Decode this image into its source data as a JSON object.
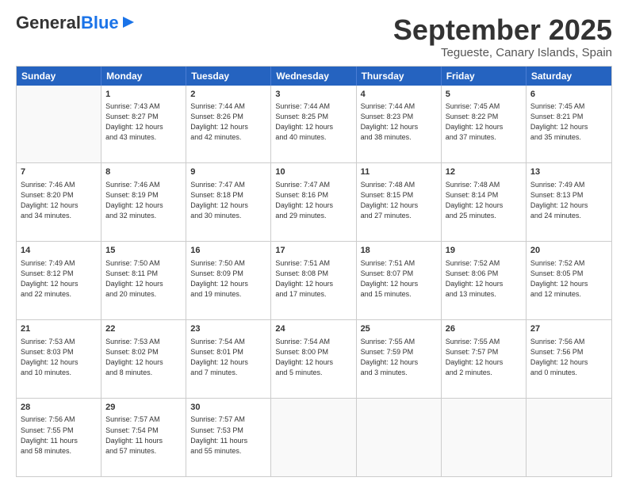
{
  "header": {
    "logo_general": "General",
    "logo_blue": "Blue",
    "main_title": "September 2025",
    "subtitle": "Tegueste, Canary Islands, Spain"
  },
  "calendar": {
    "weekdays": [
      "Sunday",
      "Monday",
      "Tuesday",
      "Wednesday",
      "Thursday",
      "Friday",
      "Saturday"
    ],
    "rows": [
      [
        {
          "day": "",
          "text": ""
        },
        {
          "day": "1",
          "text": "Sunrise: 7:43 AM\nSunset: 8:27 PM\nDaylight: 12 hours\nand 43 minutes."
        },
        {
          "day": "2",
          "text": "Sunrise: 7:44 AM\nSunset: 8:26 PM\nDaylight: 12 hours\nand 42 minutes."
        },
        {
          "day": "3",
          "text": "Sunrise: 7:44 AM\nSunset: 8:25 PM\nDaylight: 12 hours\nand 40 minutes."
        },
        {
          "day": "4",
          "text": "Sunrise: 7:44 AM\nSunset: 8:23 PM\nDaylight: 12 hours\nand 38 minutes."
        },
        {
          "day": "5",
          "text": "Sunrise: 7:45 AM\nSunset: 8:22 PM\nDaylight: 12 hours\nand 37 minutes."
        },
        {
          "day": "6",
          "text": "Sunrise: 7:45 AM\nSunset: 8:21 PM\nDaylight: 12 hours\nand 35 minutes."
        }
      ],
      [
        {
          "day": "7",
          "text": "Sunrise: 7:46 AM\nSunset: 8:20 PM\nDaylight: 12 hours\nand 34 minutes."
        },
        {
          "day": "8",
          "text": "Sunrise: 7:46 AM\nSunset: 8:19 PM\nDaylight: 12 hours\nand 32 minutes."
        },
        {
          "day": "9",
          "text": "Sunrise: 7:47 AM\nSunset: 8:18 PM\nDaylight: 12 hours\nand 30 minutes."
        },
        {
          "day": "10",
          "text": "Sunrise: 7:47 AM\nSunset: 8:16 PM\nDaylight: 12 hours\nand 29 minutes."
        },
        {
          "day": "11",
          "text": "Sunrise: 7:48 AM\nSunset: 8:15 PM\nDaylight: 12 hours\nand 27 minutes."
        },
        {
          "day": "12",
          "text": "Sunrise: 7:48 AM\nSunset: 8:14 PM\nDaylight: 12 hours\nand 25 minutes."
        },
        {
          "day": "13",
          "text": "Sunrise: 7:49 AM\nSunset: 8:13 PM\nDaylight: 12 hours\nand 24 minutes."
        }
      ],
      [
        {
          "day": "14",
          "text": "Sunrise: 7:49 AM\nSunset: 8:12 PM\nDaylight: 12 hours\nand 22 minutes."
        },
        {
          "day": "15",
          "text": "Sunrise: 7:50 AM\nSunset: 8:11 PM\nDaylight: 12 hours\nand 20 minutes."
        },
        {
          "day": "16",
          "text": "Sunrise: 7:50 AM\nSunset: 8:09 PM\nDaylight: 12 hours\nand 19 minutes."
        },
        {
          "day": "17",
          "text": "Sunrise: 7:51 AM\nSunset: 8:08 PM\nDaylight: 12 hours\nand 17 minutes."
        },
        {
          "day": "18",
          "text": "Sunrise: 7:51 AM\nSunset: 8:07 PM\nDaylight: 12 hours\nand 15 minutes."
        },
        {
          "day": "19",
          "text": "Sunrise: 7:52 AM\nSunset: 8:06 PM\nDaylight: 12 hours\nand 13 minutes."
        },
        {
          "day": "20",
          "text": "Sunrise: 7:52 AM\nSunset: 8:05 PM\nDaylight: 12 hours\nand 12 minutes."
        }
      ],
      [
        {
          "day": "21",
          "text": "Sunrise: 7:53 AM\nSunset: 8:03 PM\nDaylight: 12 hours\nand 10 minutes."
        },
        {
          "day": "22",
          "text": "Sunrise: 7:53 AM\nSunset: 8:02 PM\nDaylight: 12 hours\nand 8 minutes."
        },
        {
          "day": "23",
          "text": "Sunrise: 7:54 AM\nSunset: 8:01 PM\nDaylight: 12 hours\nand 7 minutes."
        },
        {
          "day": "24",
          "text": "Sunrise: 7:54 AM\nSunset: 8:00 PM\nDaylight: 12 hours\nand 5 minutes."
        },
        {
          "day": "25",
          "text": "Sunrise: 7:55 AM\nSunset: 7:59 PM\nDaylight: 12 hours\nand 3 minutes."
        },
        {
          "day": "26",
          "text": "Sunrise: 7:55 AM\nSunset: 7:57 PM\nDaylight: 12 hours\nand 2 minutes."
        },
        {
          "day": "27",
          "text": "Sunrise: 7:56 AM\nSunset: 7:56 PM\nDaylight: 12 hours\nand 0 minutes."
        }
      ],
      [
        {
          "day": "28",
          "text": "Sunrise: 7:56 AM\nSunset: 7:55 PM\nDaylight: 11 hours\nand 58 minutes."
        },
        {
          "day": "29",
          "text": "Sunrise: 7:57 AM\nSunset: 7:54 PM\nDaylight: 11 hours\nand 57 minutes."
        },
        {
          "day": "30",
          "text": "Sunrise: 7:57 AM\nSunset: 7:53 PM\nDaylight: 11 hours\nand 55 minutes."
        },
        {
          "day": "",
          "text": ""
        },
        {
          "day": "",
          "text": ""
        },
        {
          "day": "",
          "text": ""
        },
        {
          "day": "",
          "text": ""
        }
      ]
    ]
  }
}
